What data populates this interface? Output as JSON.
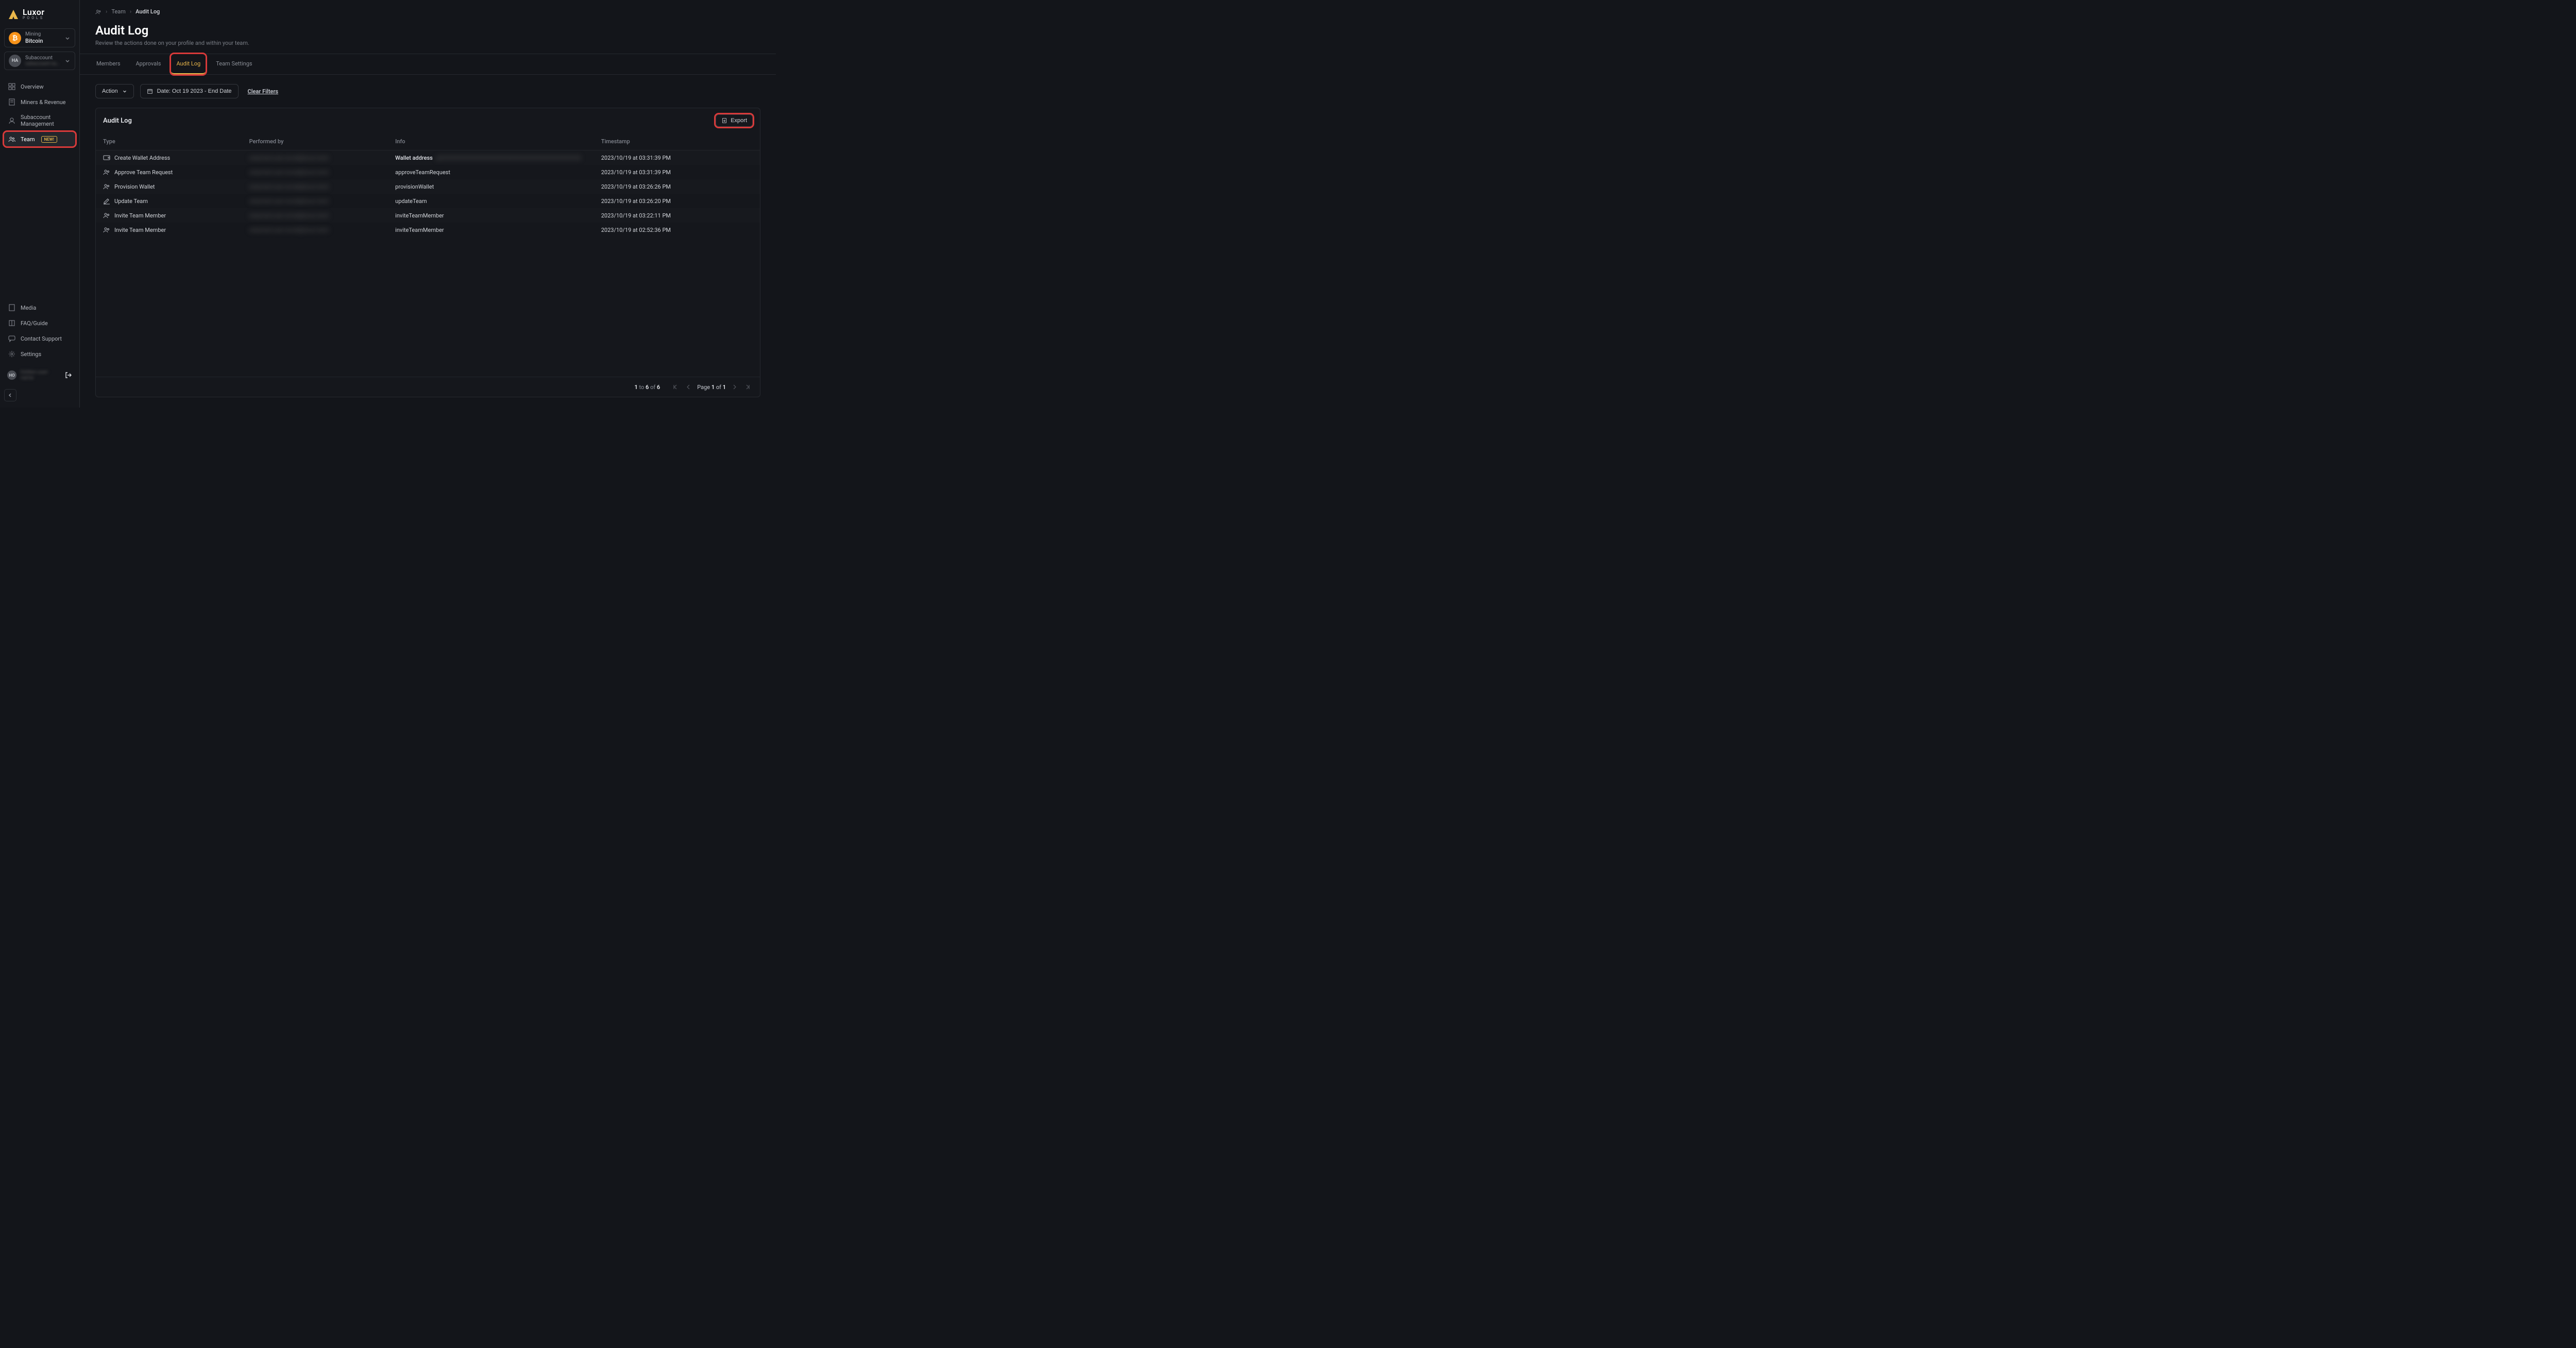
{
  "brand": {
    "name": "Luxor",
    "sub": "POOLS"
  },
  "mining_selector": {
    "label": "Mining",
    "value": "Bitcoin"
  },
  "subaccount_selector": {
    "label": "Subaccount",
    "value": "subaccount-name-hidden"
  },
  "sidebar": {
    "items": [
      {
        "label": "Overview",
        "icon": "grid"
      },
      {
        "label": "Miners & Revenue",
        "icon": "doc"
      },
      {
        "label": "Subaccount Management",
        "icon": "user"
      },
      {
        "label": "Team",
        "icon": "team",
        "badge": "NEW!",
        "active": true
      }
    ],
    "bottom": [
      {
        "label": "Media",
        "icon": "doc"
      },
      {
        "label": "FAQ/Guide",
        "icon": "book"
      },
      {
        "label": "Contact Support",
        "icon": "chat"
      },
      {
        "label": "Settings",
        "icon": "gear"
      }
    ]
  },
  "user": {
    "initials": "HO",
    "name": "hidden-user-name"
  },
  "breadcrumb": {
    "team": "Team",
    "current": "Audit Log"
  },
  "header": {
    "title": "Audit Log",
    "subtitle": "Review the actions done on your profile and within your team."
  },
  "tabs": [
    {
      "label": "Members"
    },
    {
      "label": "Approvals"
    },
    {
      "label": "Audit Log",
      "active": true
    },
    {
      "label": "Team Settings"
    }
  ],
  "filters": {
    "action_label": "Action",
    "date_label": "Date: Oct 19 2023 - End Date",
    "clear_label": "Clear Filters"
  },
  "panel": {
    "title": "Audit Log",
    "export_label": "Export",
    "columns": {
      "type": "Type",
      "performed": "Performed by",
      "info": "Info",
      "timestamp": "Timestamp"
    },
    "rows": [
      {
        "type": "Create Wallet Address",
        "icon": "wallet",
        "performed": "redacted-user-email@luxor.tech",
        "info_prefix": "Wallet address",
        "info": "qXXXXXXXXXXXXXXXXXXXXXXXXXXXXXXXXXXXXXXXX",
        "timestamp": "2023/10/19 at 03:31:39 PM"
      },
      {
        "type": "Approve Team Request",
        "icon": "team",
        "performed": "redacted-user-email@luxor.tech",
        "info_prefix": "",
        "info": "approveTeamRequest",
        "timestamp": "2023/10/19 at 03:31:39 PM"
      },
      {
        "type": "Provision Wallet",
        "icon": "team",
        "performed": "redacted-user-email@luxor.tech",
        "info_prefix": "",
        "info": "provisionWallet",
        "timestamp": "2023/10/19 at 03:26:26 PM"
      },
      {
        "type": "Update Team",
        "icon": "edit",
        "performed": "redacted-user-email@luxor.tech",
        "info_prefix": "",
        "info": "updateTeam",
        "timestamp": "2023/10/19 at 03:26:20 PM"
      },
      {
        "type": "Invite Team Member",
        "icon": "team",
        "performed": "redacted-user-email@luxor.tech",
        "info_prefix": "",
        "info": "inviteTeamMember",
        "timestamp": "2023/10/19 at 03:22:11 PM"
      },
      {
        "type": "Invite Team Member",
        "icon": "team",
        "performed": "redacted-user-email@luxor.tech",
        "info_prefix": "",
        "info": "inviteTeamMember",
        "timestamp": "2023/10/19 at 02:52:36 PM"
      }
    ],
    "footer": {
      "range_from": "1",
      "range_to": "6",
      "range_of": "of",
      "range_total": "6",
      "page_label_prefix": "Page",
      "page_current": "1",
      "page_of": "of",
      "page_total": "1"
    }
  }
}
